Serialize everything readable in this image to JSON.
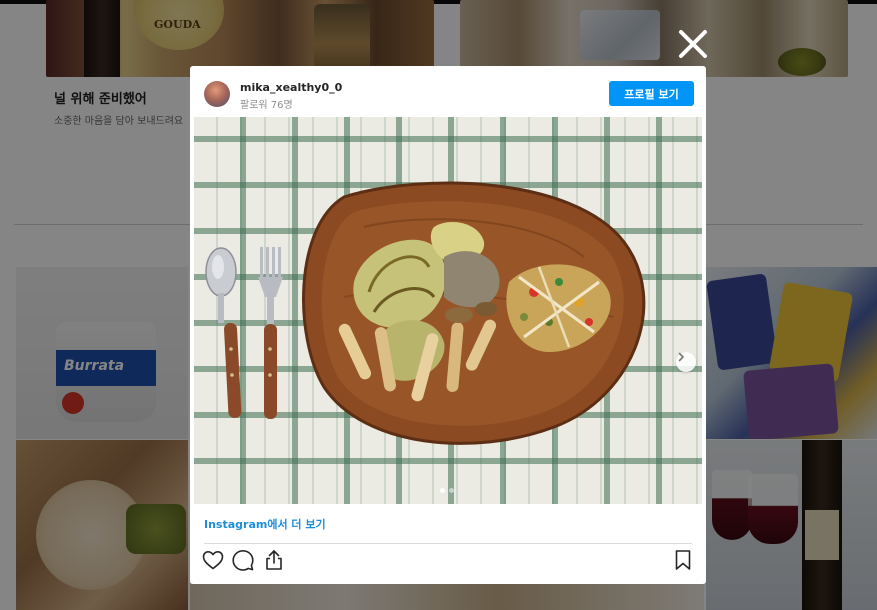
{
  "background": {
    "card_title": "널 위해 준비했어",
    "card_desc": "소중한 마음을 담아 보내드려요"
  },
  "brand_labels": {
    "gouda": "GOUDA",
    "burrata": "Burrata"
  },
  "close": {
    "icon": "close-icon"
  },
  "post": {
    "username": "mika_xealthy0_0",
    "followers": "팔로워 76명",
    "profile_button": "프로필 보기",
    "carousel": {
      "current_slide": 1,
      "total_slides": 2
    },
    "view_more_link": "Instagram에서 더 보기",
    "actions": [
      "heart-icon",
      "comment-icon",
      "share-icon",
      "bookmark-icon"
    ]
  },
  "colors": {
    "accent": "#0095f6",
    "link": "#1d8dd8",
    "overlay": "rgba(0,0,0,0.48)"
  }
}
